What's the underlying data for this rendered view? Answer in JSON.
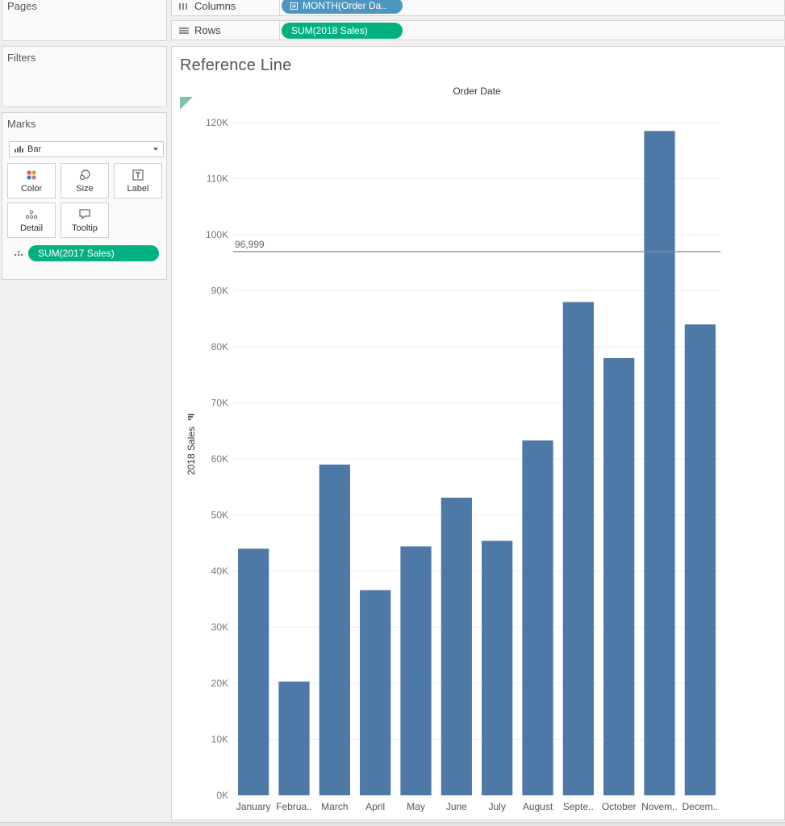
{
  "left_panel": {
    "pages_title": "Pages",
    "filters_title": "Filters",
    "marks_title": "Marks",
    "mark_type": "Bar",
    "mark_buttons": {
      "color": "Color",
      "size": "Size",
      "label": "Label",
      "detail": "Detail",
      "tooltip": "Tooltip"
    },
    "detail_pill": "SUM(2017 Sales)"
  },
  "shelves": {
    "columns_label": "Columns",
    "columns_pill": "MONTH(Order Da..",
    "rows_label": "Rows",
    "rows_pill": "SUM(2018 Sales)"
  },
  "sheet": {
    "title": "Reference Line"
  },
  "colors": {
    "bar": "#4e79a7",
    "pill_green": "#03b082",
    "pill_blue": "#4d96c1",
    "reference_line": "#888888"
  },
  "chart_data": {
    "type": "bar",
    "column_header": "Order Date",
    "ylabel": "2018 Sales",
    "categories": [
      "January",
      "Februa..",
      "March",
      "April",
      "May",
      "June",
      "July",
      "August",
      "Septe..",
      "October",
      "Novem..",
      "Decem.."
    ],
    "values": [
      44000,
      20300,
      59000,
      36600,
      44400,
      53100,
      45400,
      63300,
      88000,
      78000,
      118500,
      84000
    ],
    "ylim": [
      0,
      120000
    ],
    "yticks": [
      0,
      10000,
      20000,
      30000,
      40000,
      50000,
      60000,
      70000,
      80000,
      90000,
      100000,
      110000,
      120000
    ],
    "ytick_labels": [
      "0K",
      "10K",
      "20K",
      "30K",
      "40K",
      "50K",
      "60K",
      "70K",
      "80K",
      "90K",
      "100K",
      "110K",
      "120K"
    ],
    "reference_line": {
      "value": 96999,
      "label": "96,999"
    },
    "grid": true
  }
}
